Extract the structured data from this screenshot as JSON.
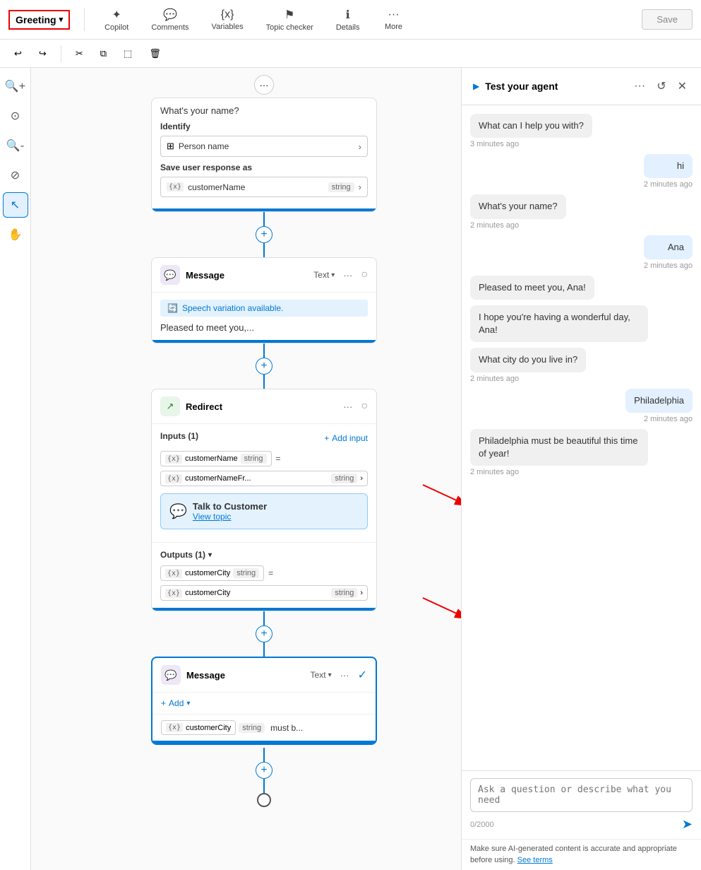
{
  "toolbar": {
    "greeting_label": "Greeting",
    "copilot_label": "Copilot",
    "comments_label": "Comments",
    "variables_label": "Variables",
    "topic_checker_label": "Topic checker",
    "details_label": "Details",
    "more_label": "More",
    "save_label": "Save"
  },
  "secondary_toolbar": {
    "undo_label": "↩",
    "redo_label": "↪",
    "cut_label": "✂",
    "copy_label": "⧉",
    "paste_label": "⬚",
    "delete_label": "🗑"
  },
  "canvas": {
    "question_node": {
      "prompt": "What's your name?",
      "identify_label": "Identify",
      "identify_value": "Person name",
      "save_label": "Save user response as",
      "variable_name": "customerName",
      "variable_type": "string"
    },
    "message_node_1": {
      "title": "Message",
      "type_label": "Text",
      "speech_banner": "Speech variation available.",
      "message_text": "Pleased to meet you,..."
    },
    "redirect_node": {
      "title": "Redirect",
      "inputs_label": "Inputs (1)",
      "add_input_label": "Add input",
      "input_var": "customerName",
      "input_type": "string",
      "input_source_var": "customerNameFr...",
      "input_source_type": "string",
      "talk_title": "Talk to Customer",
      "view_topic_label": "View topic",
      "outputs_label": "Outputs (1)",
      "output_var": "customerCity",
      "output_type": "string",
      "output_dest_var": "customerCity",
      "output_dest_type": "string"
    },
    "message_node_2": {
      "title": "Message",
      "type_label": "Text",
      "add_label": "Add",
      "variable": "customerCity",
      "var_type": "string",
      "var_suffix": "must b..."
    }
  },
  "right_panel": {
    "title": "Test your agent",
    "chat_messages": [
      {
        "type": "bot",
        "text": "What can I help you with?",
        "time": "3 minutes ago"
      },
      {
        "type": "user",
        "text": "hi",
        "time": "2 minutes ago"
      },
      {
        "type": "bot",
        "text": "What's your name?",
        "time": "2 minutes ago"
      },
      {
        "type": "user",
        "text": "Ana",
        "time": "2 minutes ago"
      },
      {
        "type": "bot",
        "text": "Pleased to meet you, Ana!",
        "time": ""
      },
      {
        "type": "bot",
        "text": "I hope you're having a wonderful day, Ana!",
        "time": ""
      },
      {
        "type": "bot",
        "text": "What city do you live in?",
        "time": "2 minutes ago"
      },
      {
        "type": "user",
        "text": "Philadelphia",
        "time": "2 minutes ago"
      },
      {
        "type": "bot",
        "text": "Philadelphia must be beautiful this time of year!",
        "time": "2 minutes ago"
      }
    ],
    "input_placeholder": "Ask a question or describe what you need",
    "char_count": "0/2000",
    "disclaimer": "Make sure AI-generated content is accurate and appropriate before using.",
    "see_terms": "See terms"
  },
  "left_tools": {
    "zoom_in": "+",
    "target": "⊙",
    "zoom_out": "−",
    "ban": "⊘",
    "cursor": "↖",
    "hand": "✋"
  }
}
